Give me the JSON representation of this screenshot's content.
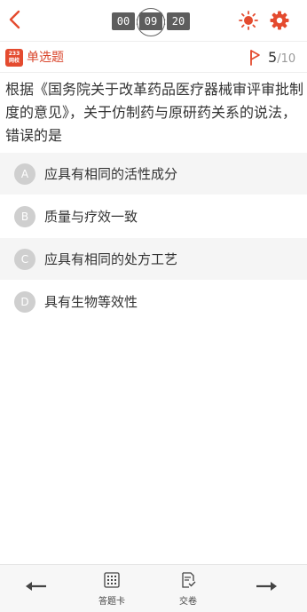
{
  "timer": {
    "hours": "00",
    "minutes": "09",
    "seconds": "20"
  },
  "question_type": "单选题",
  "logo_text": "233网校",
  "progress": {
    "current": "5",
    "separator": "/",
    "total": "10"
  },
  "question_text": "根据《国务院关于改革药品医疗器械审评审批制度的意见》，关于仿制药与原研药关系的说法，错误的是",
  "options": [
    {
      "letter": "A",
      "text": "应具有相同的活性成分"
    },
    {
      "letter": "B",
      "text": "质量与疗效一致"
    },
    {
      "letter": "C",
      "text": "应具有相同的处方工艺"
    },
    {
      "letter": "D",
      "text": "具有生物等效性"
    }
  ],
  "bottom": {
    "card_label": "答题卡",
    "submit_label": "交卷"
  },
  "colors": {
    "accent": "#e44b2f",
    "timer_bg": "#5d5d5d",
    "option_bg": "#f5f5f5"
  },
  "icons": [
    "back-icon",
    "sun-icon",
    "gear-icon",
    "flag-icon",
    "prev-arrow-icon",
    "grid-icon",
    "submit-icon",
    "next-arrow-icon"
  ]
}
